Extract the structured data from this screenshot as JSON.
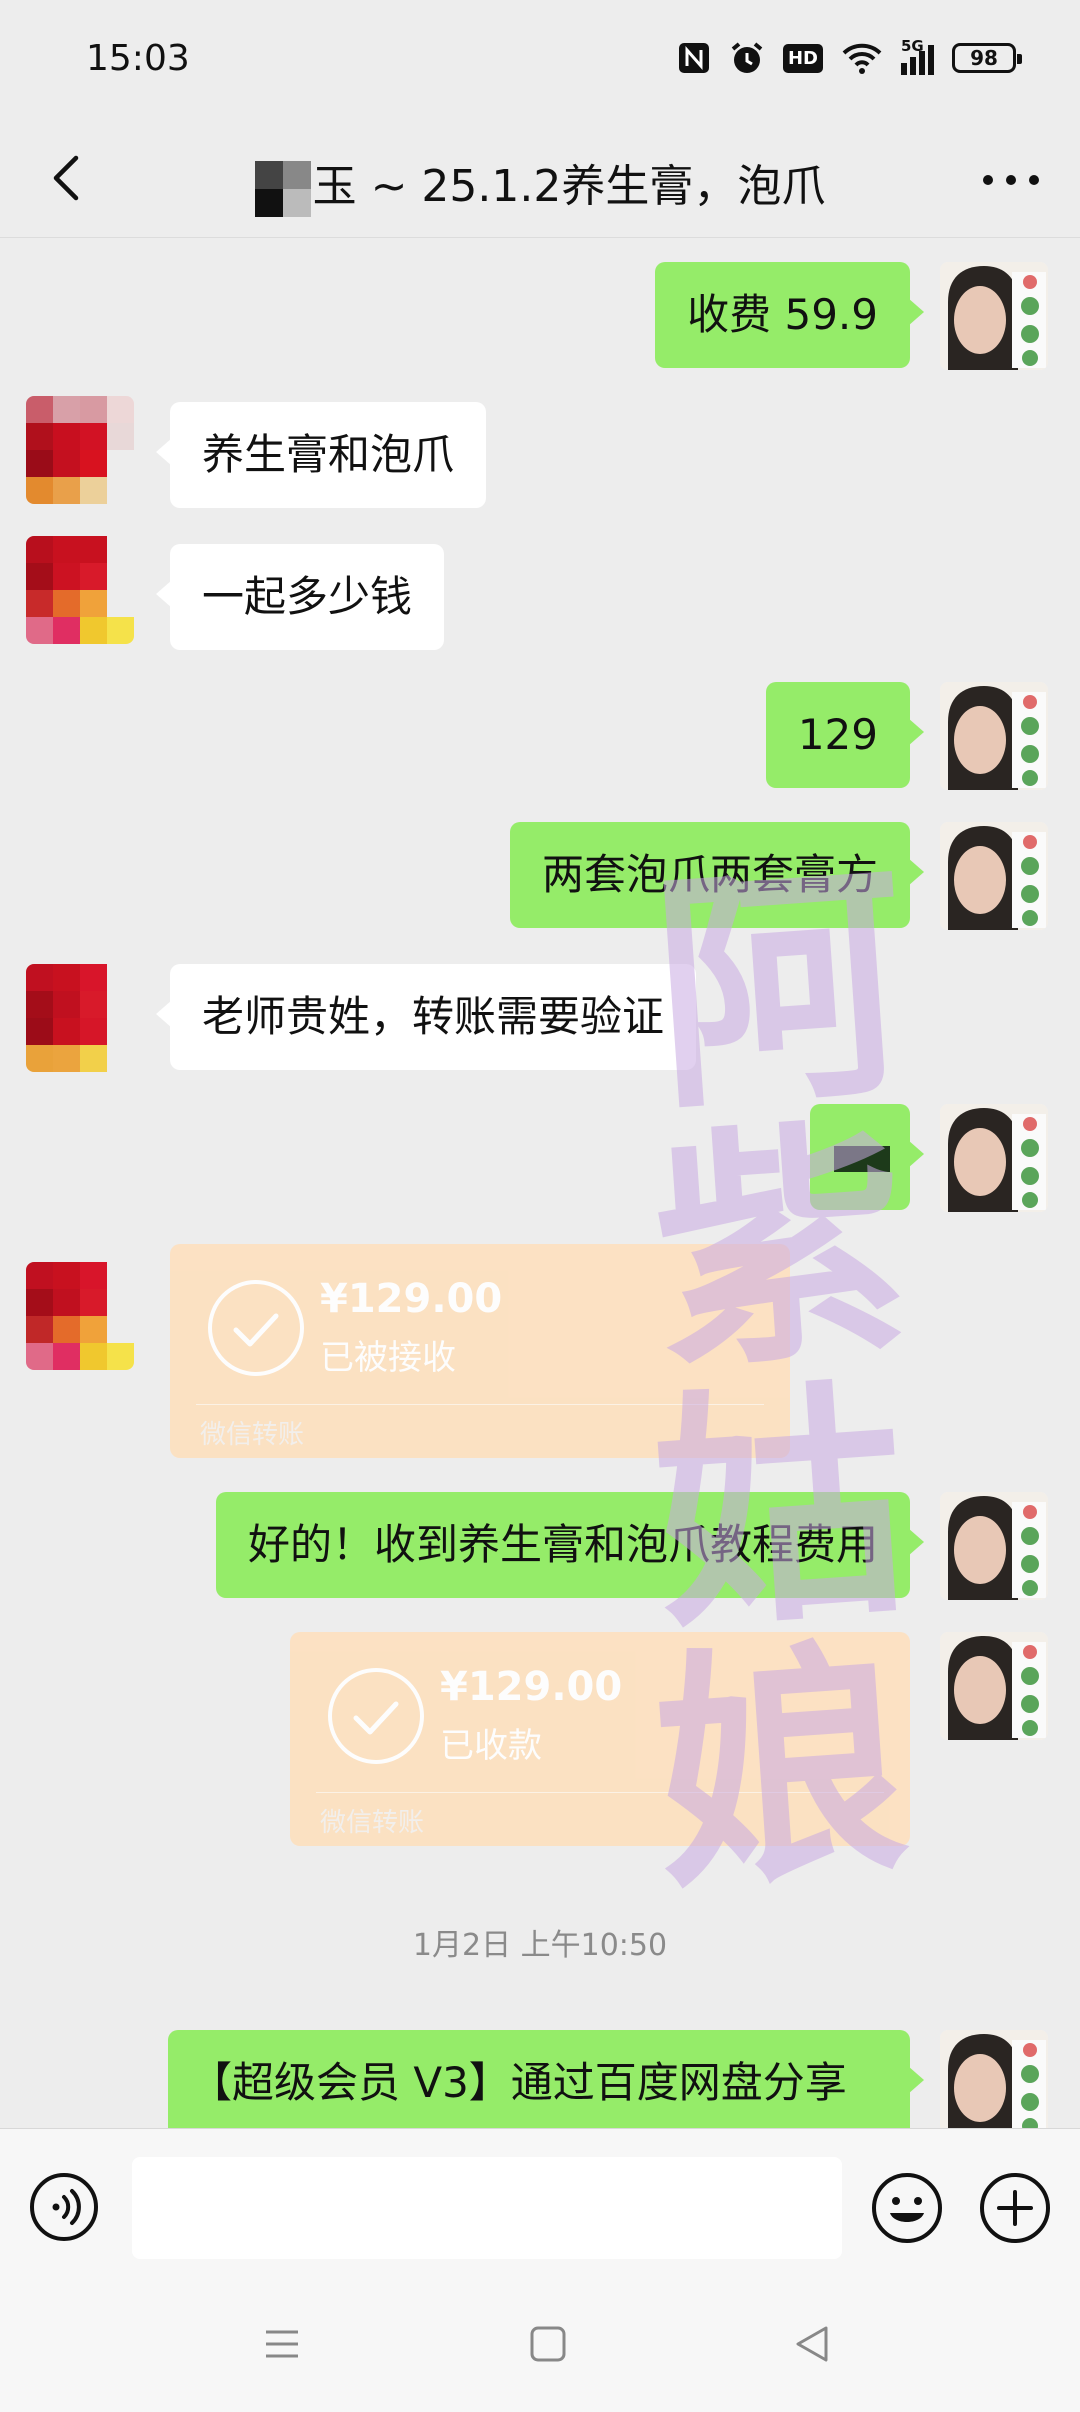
{
  "status": {
    "time": "15:03",
    "battery": "98",
    "network": "5G",
    "hd": "HD"
  },
  "nav": {
    "title": "玉 ~ 25.1.2养生膏，泡爪"
  },
  "messages": {
    "m1": "收费 59.9",
    "m2": "养生膏和泡爪",
    "m3": "一起多少钱",
    "m4": "129",
    "m5": "两套泡爪两套膏方",
    "m6": "老师贵姓，转账需要验证",
    "m8": "好的！收到养生膏和泡爪教程费用",
    "m9": "【超级会员 V3】通过百度网盘分享"
  },
  "transfers": {
    "t1": {
      "amount": "¥129.00",
      "status": "已被接收",
      "source": "微信转账"
    },
    "t2": {
      "amount": "¥129.00",
      "status": "已收款",
      "source": "微信转账"
    }
  },
  "timestamp": "1月2日 上午10:50",
  "watermark": [
    "阿",
    "紫",
    "姑",
    "娘"
  ],
  "colors": {
    "bubble_out": "#95ec69",
    "bubble_in": "#ffffff",
    "transfer": "#fde0bf",
    "background": "#ededed"
  }
}
